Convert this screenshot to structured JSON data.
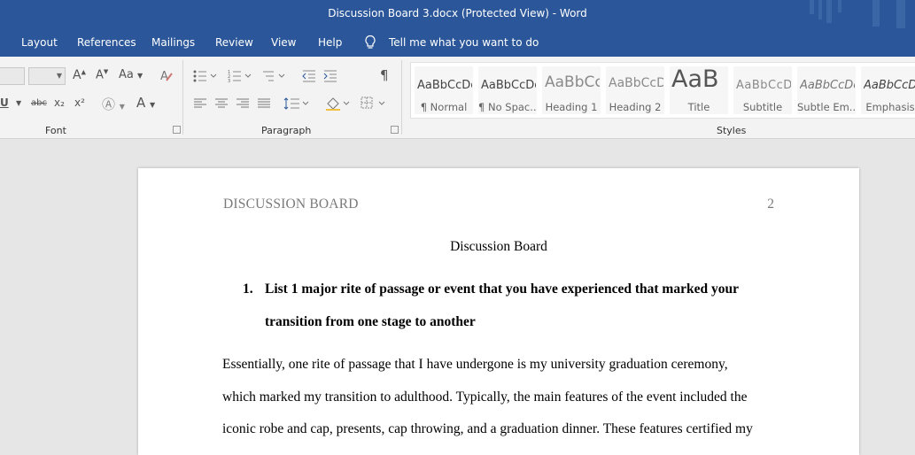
{
  "window": {
    "title": "Discussion Board 3.docx (Protected View)  -  Word"
  },
  "menu": {
    "items": [
      "Layout",
      "References",
      "Mailings",
      "Review",
      "View",
      "Help"
    ],
    "tell_me": "Tell me what you want to do",
    "tell_me_icon": "lightbulb-icon"
  },
  "ribbon": {
    "groups": {
      "font": "Font",
      "paragraph": "Paragraph",
      "styles": "Styles"
    },
    "font_controls": {
      "underline": "U",
      "strikethrough": "abc",
      "subscript": "x₂",
      "superscript": "x²",
      "change_case": "Aa",
      "font_color": "A"
    },
    "paragraph_controls": {
      "show_hide": "¶"
    },
    "styles": [
      {
        "sample": "AaBbCcDc",
        "name": "¶ Normal"
      },
      {
        "sample": "AaBbCcDc",
        "name": "¶ No Spac..."
      },
      {
        "sample": "AaBbCc",
        "name": "Heading 1"
      },
      {
        "sample": "AaBbCcD",
        "name": "Heading 2"
      },
      {
        "sample": "AaB",
        "name": "Title"
      },
      {
        "sample": "AaBbCcD",
        "name": "Subtitle"
      },
      {
        "sample": "AaBbCcDc",
        "name": "Subtle Em..."
      },
      {
        "sample": "AaBbCcDc",
        "name": "Emphasis"
      }
    ]
  },
  "document": {
    "header_left": "DISCUSSION BOARD",
    "header_right": "2",
    "title": "Discussion Board",
    "list_number": "1.",
    "list_lines": [
      "List 1 major rite of passage or event that you have experienced that marked your",
      "transition from one stage to another"
    ],
    "body_lines": [
      "Essentially, one rite of passage that I have undergone is my university graduation ceremony,",
      "which marked my transition to adulthood. Typically, the main features of the event included the",
      "iconic robe and cap, presents, cap throwing, and a graduation dinner. These features certified my"
    ]
  },
  "colors": {
    "accent": "#2b579a",
    "ribbon": "#f3f3f3",
    "workspace": "#e6e6e6"
  }
}
